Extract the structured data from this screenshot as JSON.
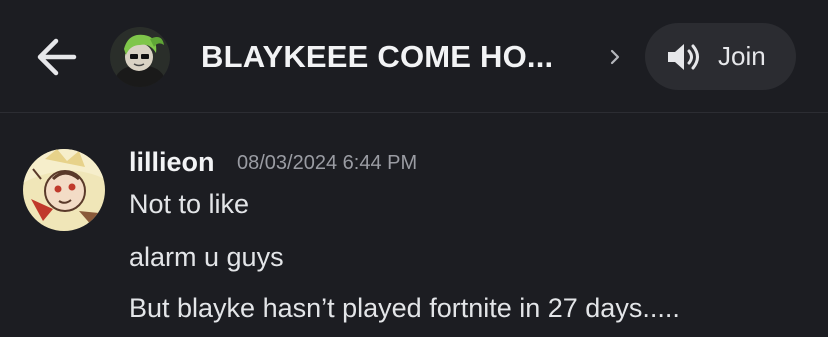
{
  "header": {
    "title": "BLAYKEEE COME HO...",
    "join_label": "Join",
    "icons": {
      "back": "arrow-left-icon",
      "chevron": "chevron-right-icon",
      "join": "speaker-icon"
    }
  },
  "message": {
    "username": "lillieon",
    "timestamp": "08/03/2024 6:44 PM",
    "lines": [
      "Not to like",
      "alarm u guys",
      "But blayke hasn’t played fortnite in 27 days....."
    ]
  },
  "colors": {
    "background": "#1c1d22",
    "join_button": "#2b2c31",
    "text_primary": "#f2f3f5",
    "text_muted": "#9a9ca3",
    "group_avatar_accent": "#7fc64a"
  }
}
